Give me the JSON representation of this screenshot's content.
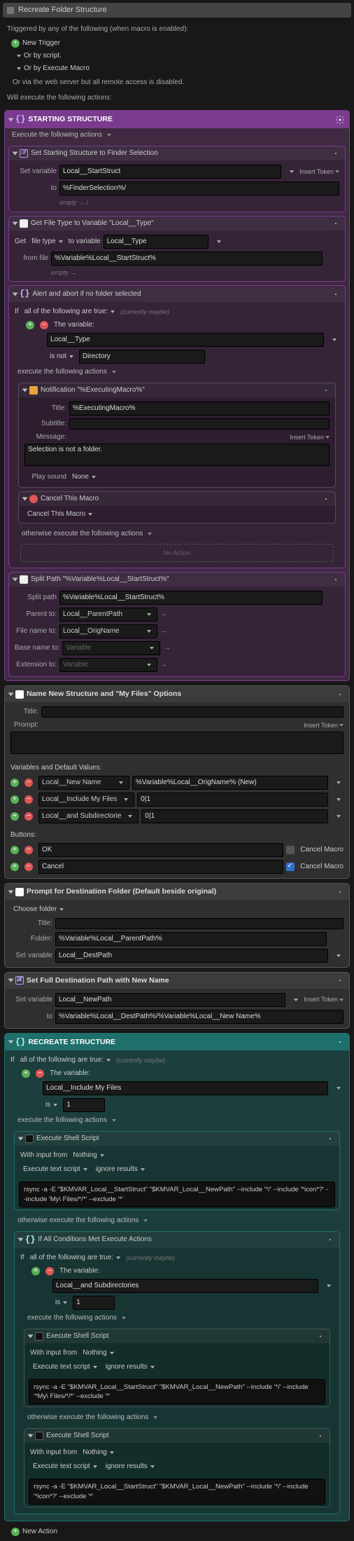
{
  "title": "Recreate Folder Structure",
  "trigger_intro": "Triggered by any of the following (when macro is enabled):",
  "new_trigger": "New Trigger",
  "or_script": "Or by script.",
  "or_exec": "Or by Execute Macro",
  "or_web": "Or via the web server but all remote access is disabled.",
  "will_exec": "Will execute the following actions:",
  "start": {
    "title": "STARTING STRUCTURE",
    "exec": "Execute the following actions",
    "card1": {
      "title": "Set Starting Structure to Finder Selection",
      "setvar": "Set variable",
      "var": "Local__StartStruct",
      "insert": "Insert Token",
      "to": "to",
      "val": "%FinderSelection%/",
      "empty": "empty",
      "arrow": "→ i"
    },
    "card2": {
      "title": "Get File Type to Variable \"Local__Type\"",
      "get": "Get",
      "ft": "file type",
      "tovar": "to variable",
      "var": "Local__Type",
      "from": "from file",
      "val": "%Variable%Local__StartStruct%",
      "empty": "empty",
      "arrow": "→"
    },
    "alert": {
      "title": "Alert and abort if no folder selected",
      "if": "If",
      "all": "all of the following are true:",
      "maybe": "(currently maybe)",
      "thevar": "The variable:",
      "var": "Local__Type",
      "isnot": "is not",
      "dir": "Directory",
      "exec": "execute the following actions",
      "notif": {
        "title": "Notification \"%ExecutingMacro%\"",
        "t": "Title:",
        "tv": "%ExecutingMacro%",
        "s": "Subtitle:",
        "m": "Message:",
        "msg": "Selection is not a folder.",
        "ps": "Play sound",
        "none": "None",
        "insert": "Insert Token"
      },
      "cancel": {
        "title": "Cancel This Macro",
        "lbl": "Cancel This Macro"
      },
      "otherwise": "otherwise execute the following actions",
      "noaction": "No Action"
    },
    "split": {
      "title": "Split Path \"%Variable%Local__StartStruct%\"",
      "sp": "Split path",
      "val": "%Variable%Local__StartStruct%",
      "parent": "Parent to:",
      "pv": "Local__ParentPath",
      "file": "File name to:",
      "fv": "Local__OrigName",
      "base": "Base name to:",
      "bv": "Variable",
      "ext": "Extension to:",
      "ev": "Variable"
    }
  },
  "nn": {
    "title": "Name New Structure and \"My Files\" Options",
    "ttl": "Title:",
    "prm": "Prompt:",
    "insert": "Insert Token",
    "vdv": "Variables and Default Values:",
    "v1": "Local__New Name",
    "d1": "%Variable%Local__OrigName% (New)",
    "v2": "Local__Include My Files",
    "d2": "0|1",
    "v3": "Local__and Subdirectorie",
    "d3": "0|1",
    "btns": "Buttons:",
    "ok": "OK",
    "cancel": "Cancel",
    "cm": "Cancel Macro"
  },
  "dest": {
    "title": "Prompt for Destination Folder (Default beside original)",
    "choose": "Choose folder",
    "ttl": "Title:",
    "fld": "Folder:",
    "fv": "%Variable%Local__ParentPath%",
    "sv": "Set variable",
    "svv": "Local__DestPath"
  },
  "full": {
    "title": "Set Full Destination Path with New Name",
    "sv": "Set variable",
    "var": "Local__NewPath",
    "insert": "Insert Token",
    "to": "to",
    "val": "%Variable%Local__DestPath%/%Variable%Local__New Name%"
  },
  "rec": {
    "title": "RECREATE STRUCTURE",
    "if": "If",
    "all": "all of the following are true:",
    "maybe": "(currently maybe)",
    "thevar": "The variable:",
    "var": "Local__Include My Files",
    "is": "is",
    "one": "1",
    "exec": "execute the following actions",
    "shell": {
      "title": "Execute Shell Script",
      "wi": "With input from",
      "nothing": "Nothing",
      "ets": "Execute text script",
      "ir": "ignore results",
      "s1": "rsync -a -E \"$KMVAR_Local__StartStruct\" \"$KMVAR_Local__NewPath\" --include '*/' --include '*icon*?' --include 'My\\ Files/*/*' --exclude '*'"
    },
    "otherwise": "otherwise execute the following actions",
    "inner": {
      "title": "If All Conditions Met Execute Actions",
      "var": "Local__and Subdirectories",
      "s2": "rsync -a -E \"$KMVAR_Local__StartStruct\" \"$KMVAR_Local__NewPath\" --include '*/' --include '*My\\ Files/*/*' --exclude '*'",
      "s3": "rsync -a -E \"$KMVAR_Local__StartStruct\" \"$KMVAR_Local__NewPath\" --include '*/' --include '*icon*?' --exclude '*'"
    }
  },
  "new_action": "New Action"
}
